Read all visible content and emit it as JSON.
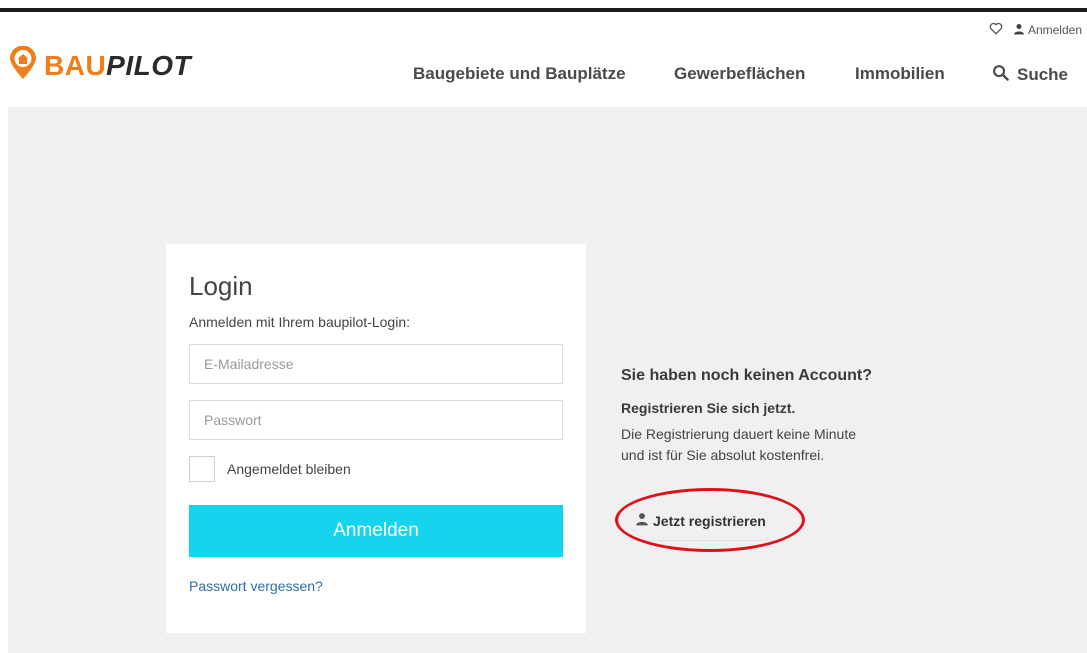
{
  "header": {
    "utility": {
      "login_label": "Anmelden"
    },
    "logo": {
      "part1": "BAU",
      "part2": "PILOT"
    },
    "nav": [
      {
        "label": "Baugebiete und Bauplätze"
      },
      {
        "label": "Gewerbeflächen"
      },
      {
        "label": "Immobilien"
      },
      {
        "label": "Suche"
      }
    ]
  },
  "login": {
    "title": "Login",
    "subtitle": "Anmelden mit Ihrem baupilot-Login:",
    "email_placeholder": "E-Mailadresse",
    "password_placeholder": "Passwort",
    "remember_label": "Angemeldet bleiben",
    "submit_label": "Anmelden",
    "forgot_label": "Passwort vergessen?"
  },
  "register": {
    "title": "Sie haben noch keinen Account?",
    "subtitle": "Registrieren Sie sich jetzt.",
    "text_line1": "Die Registrierung dauert keine Minute",
    "text_line2": "und ist für Sie absolut kostenfrei.",
    "button_label": "Jetzt registrieren"
  },
  "colors": {
    "brand_orange": "#f07d1a",
    "button_cyan": "#17d4ee",
    "link_blue": "#2b6ea8",
    "highlight_red": "#e0101a"
  }
}
